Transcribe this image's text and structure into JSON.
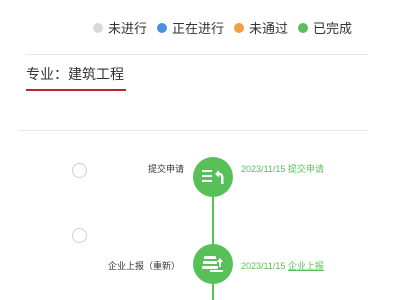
{
  "legend": [
    {
      "label": "未进行",
      "color": "#d9d9d9"
    },
    {
      "label": "正在进行",
      "color": "#4a90e2"
    },
    {
      "label": "未通过",
      "color": "#f0a03c"
    },
    {
      "label": "已完成",
      "color": "#58c058"
    }
  ],
  "major": {
    "label": "专业：建筑工程"
  },
  "steps": [
    {
      "title": "提交申请",
      "date": "2023/11/15",
      "action": "提交申请",
      "icon": "list-return-icon",
      "status": "completed"
    },
    {
      "title": "企业上报（重新）",
      "date": "2023/11/15",
      "action": "企业上报",
      "icon": "stack-upload-icon",
      "status": "completed"
    }
  ],
  "colors": {
    "completed": "#58c058",
    "accent_underline": "#b3282d"
  }
}
